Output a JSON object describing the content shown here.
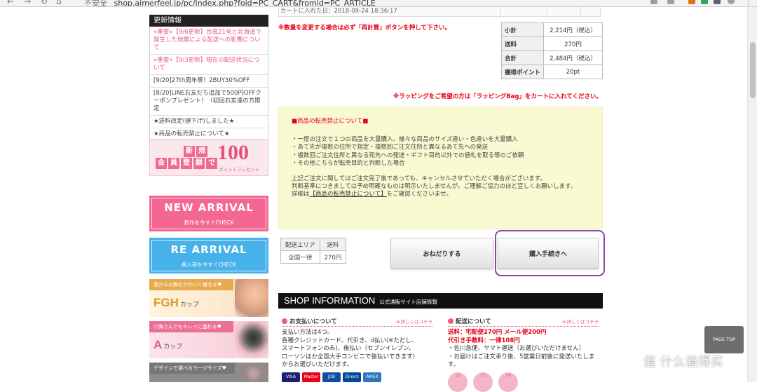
{
  "browser": {
    "security_label": "不安全",
    "url": "shop.aimerfeel.jp/pc/index.php?fold=PC_CART&fromid=PC_ARTICLE"
  },
  "sidebar": {
    "news_title": "更新情報",
    "news": [
      {
        "text": "«重要»【9/6更新】台風21号と北海道で発生した地震による配送への影響について",
        "style": "pink"
      },
      {
        "text": "«重要»【9/3更新】現在の配送状況について",
        "style": "pink"
      },
      {
        "text": "[9/20]27th周年祭！2BUY30%OFF",
        "style": "normal"
      },
      {
        "text": "[8/20]LINEお友だち追加で500円OFFクーポンプレゼント！（初回お友達の方限定",
        "style": "normal"
      },
      {
        "text": "★送料改定(値下げ)しました★",
        "style": "normal"
      },
      {
        "text": "★商品の転売禁止について★",
        "style": "normal"
      }
    ],
    "banners": {
      "member": {
        "new": "新",
        "reg": "規",
        "chips": [
          "会",
          "員",
          "登",
          "録",
          "で"
        ],
        "number": "100",
        "sub": "ポイントプレゼント"
      },
      "new_arrival": {
        "title": "NEW ARRIVAL",
        "sub": "新作を今すぐCHECK"
      },
      "re_arrival": {
        "title": "RE ARRIVAL",
        "sub": "再入荷を今すぐCHECK"
      },
      "fgh": {
        "top": "豊かなお胸をかわいく魅せる♥",
        "name": "FGH",
        "suffix": "カップ"
      },
      "a_cup": {
        "top": "小胸さんでもキレイに盛れる♥",
        "name": "A",
        "suffix": "カップ"
      },
      "large": {
        "top": "デザインで選べるラージサイズ♥"
      }
    }
  },
  "cart": {
    "date_text": "カートに入れた日：2018-09-24 18:36:17",
    "recalc_notice": "※数量を変更する場合は必ず「再計算」ボタンを押して下さい。",
    "summary": [
      {
        "label": "小計",
        "value": "2,214円（税込）"
      },
      {
        "label": "送料",
        "value": "270円"
      },
      {
        "label": "合計",
        "value": "2,484円（税込）"
      },
      {
        "label": "獲得ポイント",
        "value": "20pt"
      }
    ],
    "wrapping_notice": "※ラッピングをご希望の方は「ラッピングBag」をカートに入れてください。"
  },
  "resale": {
    "heading": "■商品の転売禁止について■",
    "bullets": [
      "・一度の注文で１つの商品を大量購入、様々な商品のサイズ違い・色違いを大量購入",
      "・あて先が複数の住所で指定・複数回ご注文住所と異なるあて先への発送",
      "・複数回ご注文住所と異なる宛先への発送・ギフト目的以外での値札を取る等のご依頼",
      "・その他こちらが転売目的と判断した場合"
    ],
    "para1": "上記ご注文に関してはご注文完了後であっても、キャンセルさせていただく場合がございます。",
    "para2": "判断基準につきましては予め明確なものは明示いたしませんが、ご理解ご協力のほど宜しくお願いします。",
    "detail_prefix": "詳細は",
    "detail_link": "【商品の転売禁止について】",
    "detail_suffix": "をご確認くださいませ。"
  },
  "shipping_table": {
    "headers": [
      "配送エリア",
      "送料"
    ],
    "row": [
      "全国一律",
      "270円"
    ]
  },
  "buttons": {
    "wish": "おねだりする",
    "checkout": "購入手続きへ"
  },
  "shop_info": {
    "title": "SHOP INFORMATION",
    "subtitle": "公式通販サイト店舗情報",
    "payment": {
      "heading": "お支払いについて",
      "more": "≫詳しくはコチラ",
      "lines": [
        "支払い方法は4つ。",
        "各種クレジットカード、代引き、d払い(※ただし、",
        "スマートフォンのみ)、後払い（セブンイレブン、",
        "ローソンほか全国大手コンビニで後払いできます）",
        "からお選びいただけます。"
      ],
      "cards": [
        "VISA",
        "Master",
        "JCB",
        "Diners",
        "AMEX"
      ]
    },
    "shipping": {
      "heading": "配送について",
      "more": "≫詳しくはコチラ",
      "red1": "送料：宅配便270円 メール便200円",
      "red2": "代引き手数料：一律108円",
      "lines": [
        "・佐川急便、ヤマト運送（お選びいただけません）",
        "・お届けはご注文承り後、5営業日前後に発送いたします。"
      ],
      "days": [
        "12",
        "13",
        "14"
      ]
    }
  },
  "page_top": "PAGE TOP",
  "watermark": "值 什么值得买"
}
